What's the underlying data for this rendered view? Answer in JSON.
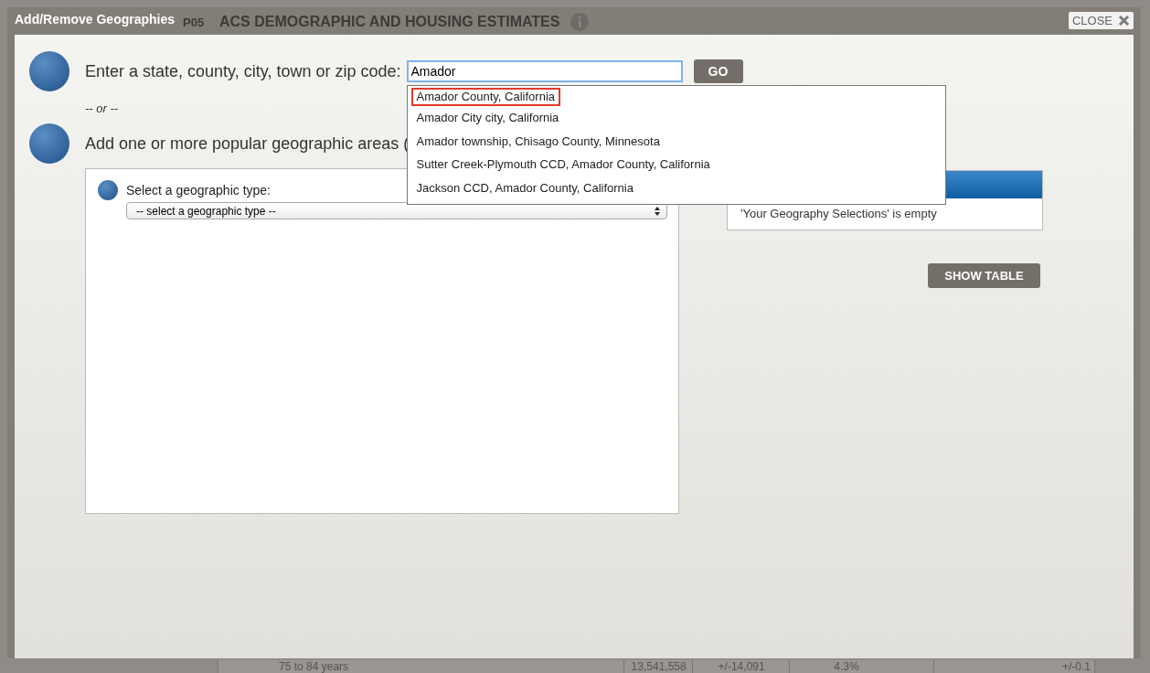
{
  "background_page": {
    "table_id": "P05",
    "title": "ACS DEMOGRAPHIC AND HOUSING ESTIMATES",
    "bottom_row": [
      "75 to 84 years",
      "13,541,558",
      "+/-14,091",
      "4.3%",
      "+/-0.1"
    ]
  },
  "dialog": {
    "title": "Add/Remove Geographies",
    "close_label": "CLOSE",
    "search": {
      "label": "Enter a state, county, city, town or zip code:",
      "value": "Amador",
      "button": "GO"
    },
    "suggestions": [
      {
        "label": "Amador County, California",
        "selected": true
      },
      {
        "label": "Amador City city, California",
        "selected": false
      },
      {
        "label": "Amador township, Chisago County, Minnesota",
        "selected": false
      },
      {
        "label": "Sutter Creek-Plymouth CCD, Amador County, California",
        "selected": false
      },
      {
        "label": "Jackson CCD, Amador County, California",
        "selected": false
      }
    ],
    "separator": "-- or --",
    "popular_label": "Add one or more popular geographic areas (",
    "type_label": "Select a geographic type:",
    "type_select": "-- select a geographic type --",
    "selections_empty": "'Your Geography Selections' is empty",
    "show_table_button": "SHOW TABLE"
  }
}
